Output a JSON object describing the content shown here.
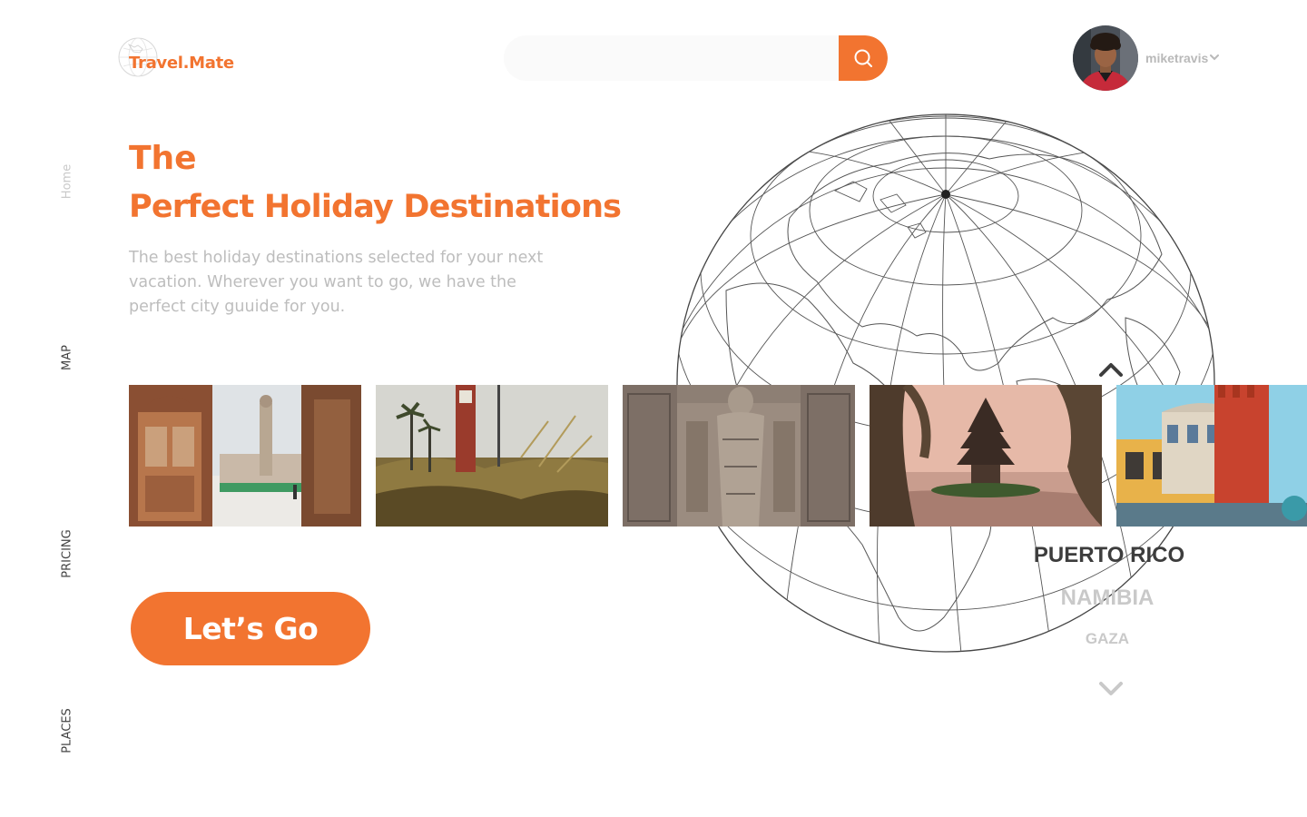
{
  "brand": {
    "logo_text": "Travel.Mate"
  },
  "search": {
    "value": "",
    "placeholder": ""
  },
  "user": {
    "name": "miketravis"
  },
  "sidenav": {
    "home": "Home",
    "map": "MAP",
    "pricing": "PRICING",
    "places": "PLACES"
  },
  "hero": {
    "title_line1": "The",
    "title_line2": "Perfect Holiday Destinations",
    "description": "The best holiday destinations selected for your next vacation. Wherever you want to go, we have the perfect city guuide for you."
  },
  "destinations": [
    "PUERTO RICO",
    "NAMIBIA",
    "GAZA"
  ],
  "cta": {
    "label": "Let’s Go"
  },
  "colors": {
    "accent": "#f27430",
    "muted": "#c9c9c9",
    "dark": "#3d3d3d"
  },
  "icons": {
    "logo": "globe-icon",
    "search": "search-icon",
    "user_menu": "chevron-down-icon",
    "list_up": "chevron-up-icon",
    "list_down": "chevron-down-icon"
  }
}
